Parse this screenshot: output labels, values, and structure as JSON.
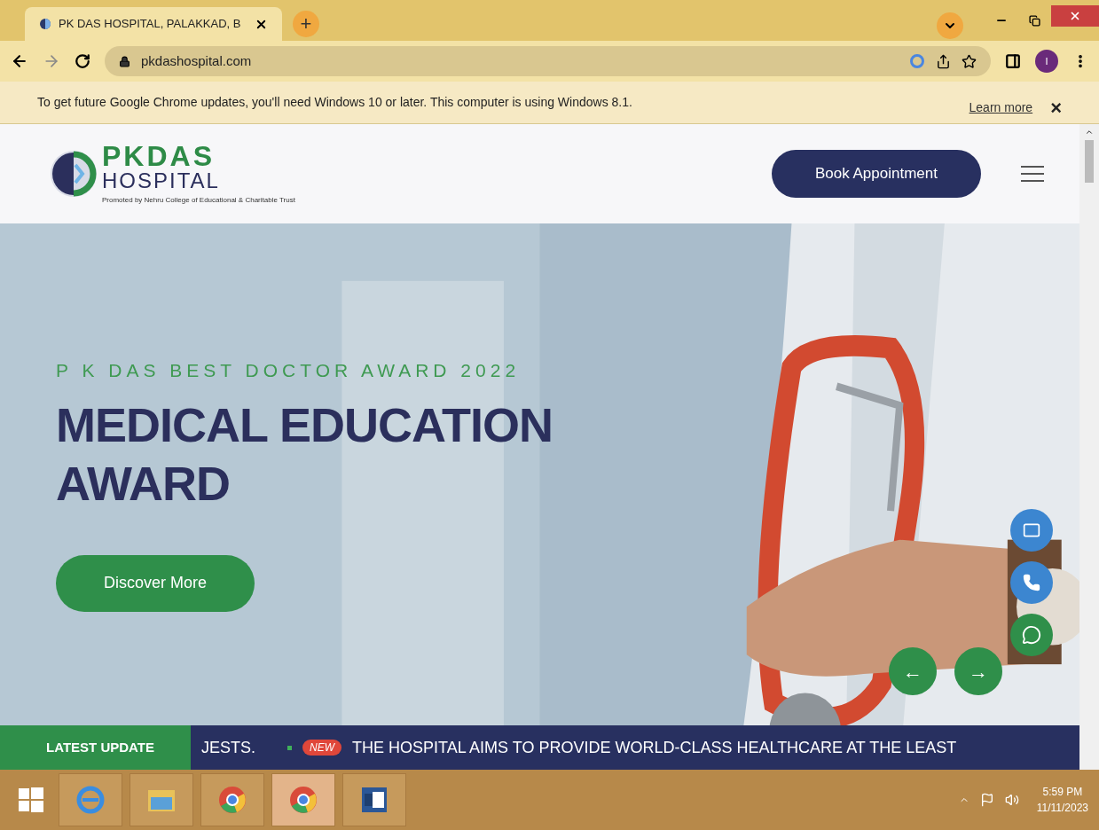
{
  "browser": {
    "tab": {
      "title": "PK DAS HOSPITAL, PALAKKAD, B",
      "selected": true
    },
    "new_tab": "+",
    "url": "pkdashospital.com",
    "profile_initial": "I"
  },
  "infobar": {
    "message": "To get future Google Chrome updates, you'll need Windows 10 or later. This computer is using Windows 8.1.",
    "link": "Learn more",
    "close": "×"
  },
  "header": {
    "logo": {
      "name_top": "PKDAS",
      "name_bottom": "HOSPITAL",
      "tagline": "Promoted by Nehru College of Educational & Charitable Trust"
    },
    "cta": "Book Appointment"
  },
  "hero": {
    "kicker": "P K DAS BEST DOCTOR AWARD 2022",
    "title": "MEDICAL EDUCATION AWARD",
    "button": "Discover More",
    "prev": "←",
    "next": "→"
  },
  "ticker": {
    "label": "LATEST UPDATE",
    "items": [
      {
        "kind": "text",
        "text": "JESTS."
      },
      {
        "kind": "new",
        "badge": "NEW",
        "text": "THE HOSPITAL AIMS TO PROVIDE WORLD-CLASS HEALTHCARE AT THE LEAST"
      }
    ]
  },
  "taskbar": {
    "apps": [
      {
        "kind": "ie",
        "selected": false
      },
      {
        "kind": "files",
        "selected": false
      },
      {
        "kind": "chrome",
        "selected": false
      },
      {
        "kind": "chrome",
        "selected": true
      },
      {
        "kind": "word",
        "selected": false
      }
    ],
    "time": "5:59 PM",
    "date": "11/11/2023"
  }
}
